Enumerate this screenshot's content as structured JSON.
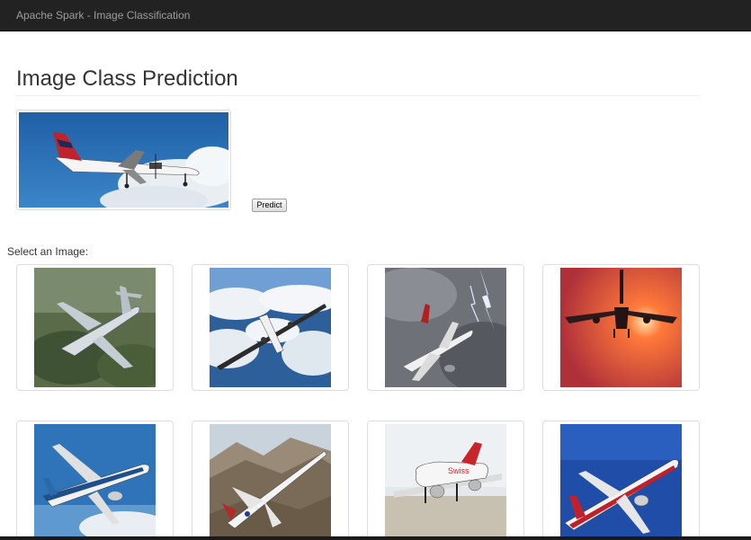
{
  "navbar": {
    "brand": "Apache Spark - Image Classification"
  },
  "page": {
    "title": "Image Class Prediction"
  },
  "selected_image": {
    "icon": "airplane-photo"
  },
  "predict": {
    "label": "Predict"
  },
  "gallery": {
    "label": "Select an Image:",
    "images": [
      {
        "icon": "business-jet-photo"
      },
      {
        "icon": "propeller-plane-over-clouds-photo"
      },
      {
        "icon": "airliner-in-storm-photo"
      },
      {
        "icon": "airliner-at-sunset-photo"
      },
      {
        "icon": "boeing-737-max-photo"
      },
      {
        "icon": "supersonic-jet-photo"
      },
      {
        "icon": "airliner-on-runway-photo"
      },
      {
        "icon": "boeing-red-white-airliner-photo"
      }
    ]
  },
  "colors": {
    "navbar_bg": "#222222",
    "navbar_text": "#9d9d9d",
    "thumb_border": "#dddddd"
  }
}
